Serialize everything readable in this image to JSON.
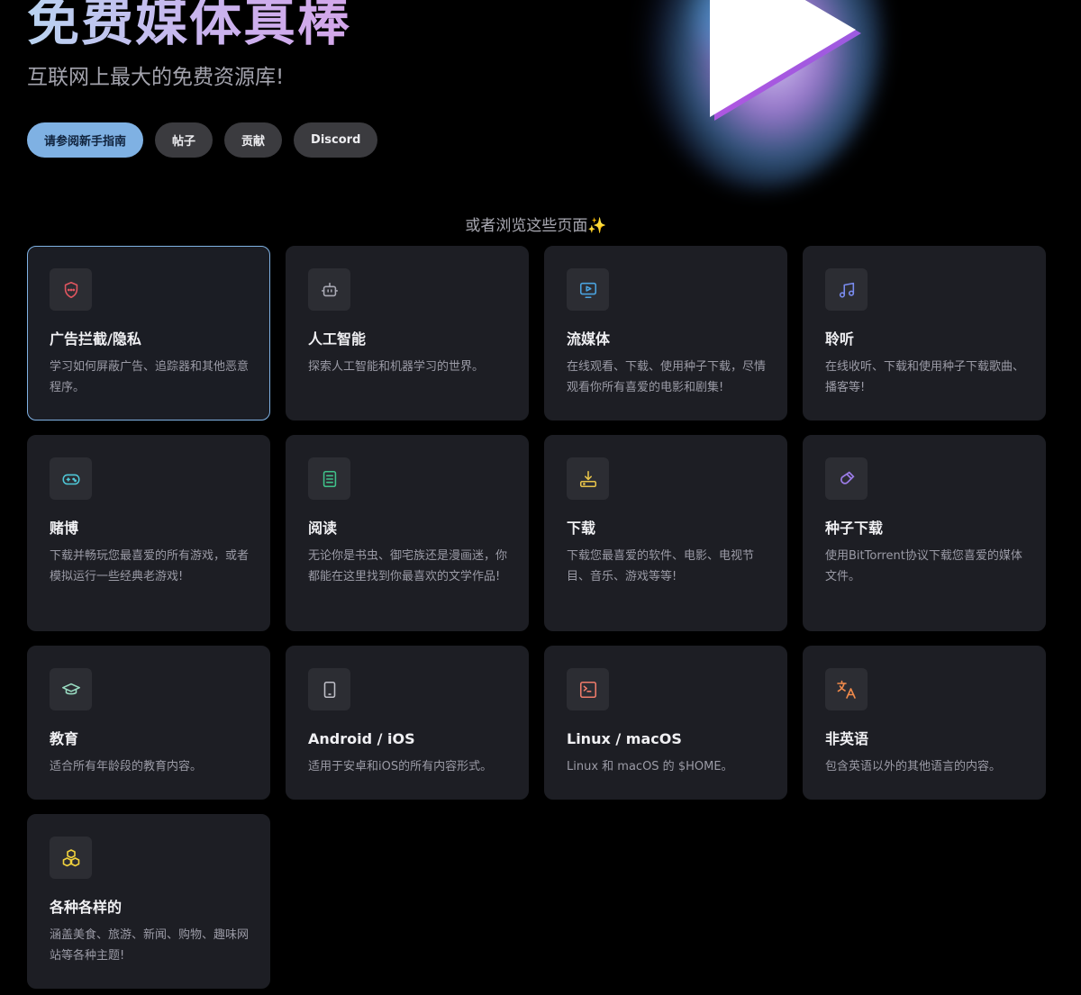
{
  "hero": {
    "title": "免费媒体真棒",
    "subtitle": "互联网上最大的免费资源库!"
  },
  "actions": [
    {
      "label": "请参阅新手指南"
    },
    {
      "label": "帖子"
    },
    {
      "label": "贡献"
    },
    {
      "label": "Discord"
    }
  ],
  "browse": {
    "title": "或者浏览这些页面✨"
  },
  "colors": {
    "accent": "#7fb1e3",
    "card_bg": "#1d1e24",
    "icon_bg": "#2c2d33"
  },
  "cards": [
    {
      "title": "广告拦截/隐私",
      "desc": "学习如何屏蔽广告、追踪器和其他恶意程序。",
      "icon": "shield-icon",
      "color": "#e0555f"
    },
    {
      "title": "人工智能",
      "desc": "探索人工智能和机器学习的世界。",
      "icon": "robot-icon",
      "color": "#a9a9b4"
    },
    {
      "title": "流媒体",
      "desc": "在线观看、下载、使用种子下载，尽情观看你所有喜爱的电影和剧集!",
      "icon": "monitor-play-icon",
      "color": "#4aa3df"
    },
    {
      "title": "聆听",
      "desc": "在线收听、下载和使用种子下载歌曲、播客等!",
      "icon": "music-note-icon",
      "color": "#7a8cf0"
    },
    {
      "title": "赌博",
      "desc": "下载并畅玩您最喜爱的所有游戏，或者模拟运行一些经典老游戏!",
      "icon": "gamepad-icon",
      "color": "#4fc8d8"
    },
    {
      "title": "阅读",
      "desc": "无论你是书虫、御宅族还是漫画迷，你都能在这里找到你最喜欢的文学作品!",
      "icon": "book-icon",
      "color": "#3fc28a"
    },
    {
      "title": "下载",
      "desc": "下载您最喜爱的软件、电影、电视节目、音乐、游戏等等!",
      "icon": "download-tray-icon",
      "color": "#e8c44a"
    },
    {
      "title": "种子下载",
      "desc": "使用BitTorrent协议下载您喜爱的媒体文件。",
      "icon": "magnet-icon",
      "color": "#9b7be6"
    },
    {
      "title": "教育",
      "desc": "适合所有年龄段的教育内容。",
      "icon": "graduation-cap-icon",
      "color": "#9adcc2"
    },
    {
      "title": "Android / iOS",
      "desc": "适用于安卓和iOS的所有内容形式。",
      "icon": "phone-icon",
      "color": "#bfbfc8"
    },
    {
      "title": "Linux / macOS",
      "desc": "Linux 和 macOS 的 $HOME。",
      "icon": "terminal-icon",
      "color": "#ef7b6a"
    },
    {
      "title": "非英语",
      "desc": "包含英语以外的其他语言的内容。",
      "icon": "translate-icon",
      "color": "#f08a4b"
    },
    {
      "title": "各种各样的",
      "desc": "涵盖美食、旅游、新闻、购物、趣味网站等各种主题!",
      "icon": "cubes-icon",
      "color": "#f1d23d"
    }
  ]
}
